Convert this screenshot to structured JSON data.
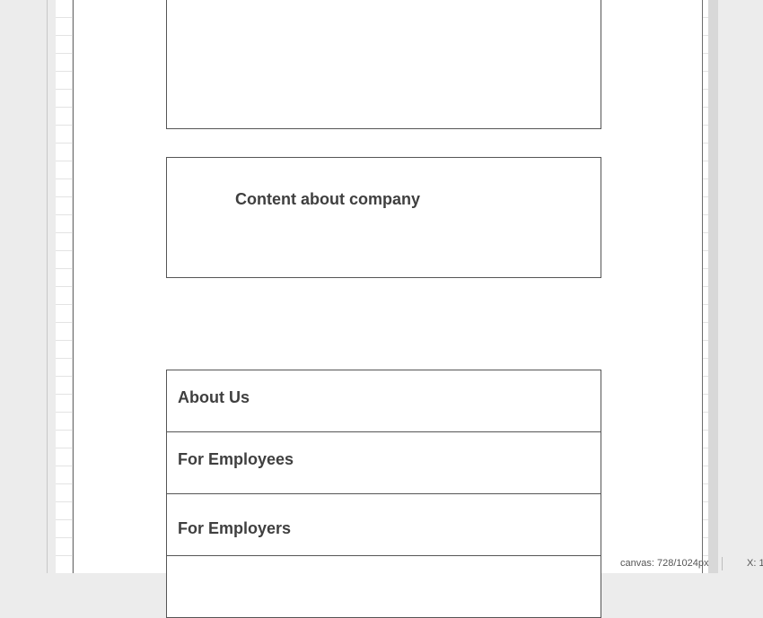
{
  "company_section": {
    "text": "Content about company"
  },
  "navigation": {
    "items": [
      {
        "label": "About Us"
      },
      {
        "label": "For Employees"
      },
      {
        "label": "For Employers"
      },
      {
        "label": ""
      }
    ]
  },
  "status_bar": {
    "canvas_size": "canvas: 728/1024px",
    "coordinates": "X: 1"
  }
}
